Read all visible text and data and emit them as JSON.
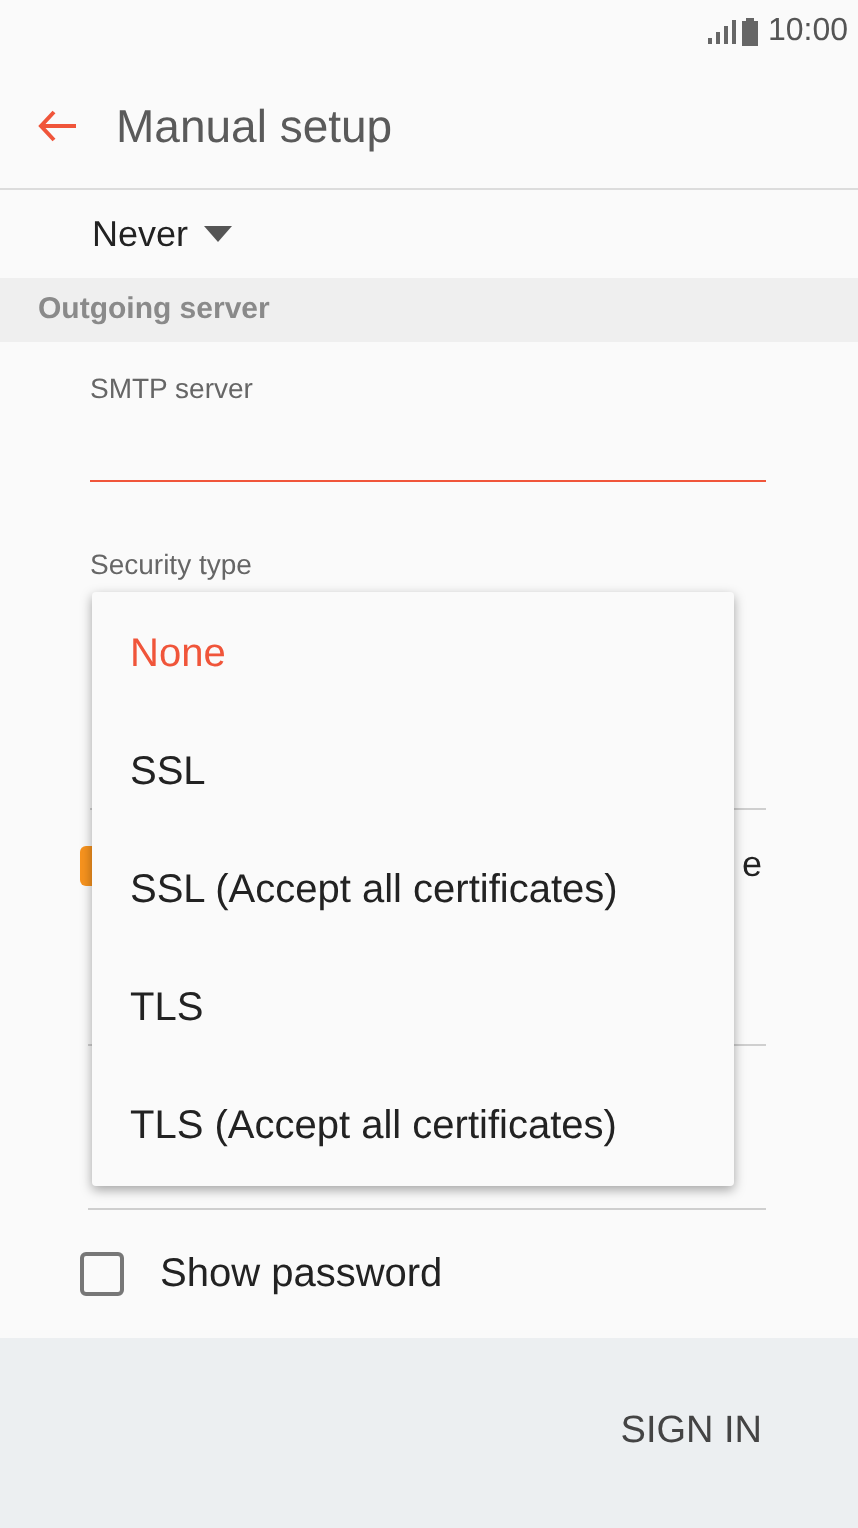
{
  "status_bar": {
    "time": "10:00"
  },
  "header": {
    "title": "Manual setup"
  },
  "sync_dropdown": {
    "value": "Never"
  },
  "section": {
    "title": "Outgoing server"
  },
  "smtp_field": {
    "label": "SMTP server",
    "focused": true
  },
  "security_field": {
    "label": "Security type"
  },
  "hidden_option": {
    "checked": true,
    "label_fragment": "e"
  },
  "security_menu": [
    {
      "label": "None",
      "selected": true
    },
    {
      "label": "SSL",
      "selected": false
    },
    {
      "label": "SSL (Accept all certificates)",
      "selected": false
    },
    {
      "label": "TLS",
      "selected": false
    },
    {
      "label": "TLS (Accept all certificates)",
      "selected": false
    }
  ],
  "show_password": {
    "label": "Show password",
    "checked": false
  },
  "footer": {
    "button": "SIGN IN"
  }
}
